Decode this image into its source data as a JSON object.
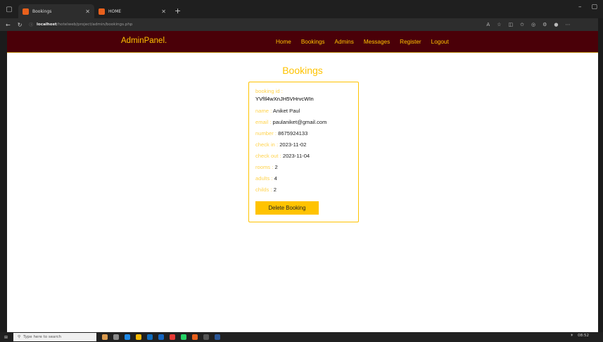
{
  "browser": {
    "tabs": [
      {
        "label": "Bookings",
        "active": true
      },
      {
        "label": "HOME",
        "active": false
      }
    ],
    "new_tab": "+",
    "url_host": "localhost",
    "url_path": "/hotelweb/project/admin/bookings.php",
    "minimize": "–",
    "restore": "▢"
  },
  "navbar": {
    "brand": "AdminPanel.",
    "links": [
      "Home",
      "Bookings",
      "Admins",
      "Messages",
      "Register",
      "Logout"
    ]
  },
  "main": {
    "heading": "Bookings",
    "booking": {
      "booking_id_label": "booking id :",
      "booking_id": "YVfIl4wXnJH5VHrvcWIn",
      "name_label": "name :",
      "name": "Aniket Paul",
      "email_label": "email :",
      "email": "paulaniket@gmail.com",
      "number_label": "number :",
      "number": "8675924133",
      "check_in_label": "check in :",
      "check_in": "2023-11-02",
      "check_out_label": "check out :",
      "check_out": "2023-11-04",
      "rooms_label": "rooms :",
      "rooms": "2",
      "adults_label": "adults :",
      "adults": "4",
      "childs_label": "childs :",
      "childs": "2",
      "delete_label": "Delete Booking"
    }
  },
  "taskbar": {
    "search_placeholder": "Type here to search",
    "time": "08:52"
  },
  "colors": {
    "navbar_bg": "#4a0008",
    "accent": "#ffc300"
  }
}
